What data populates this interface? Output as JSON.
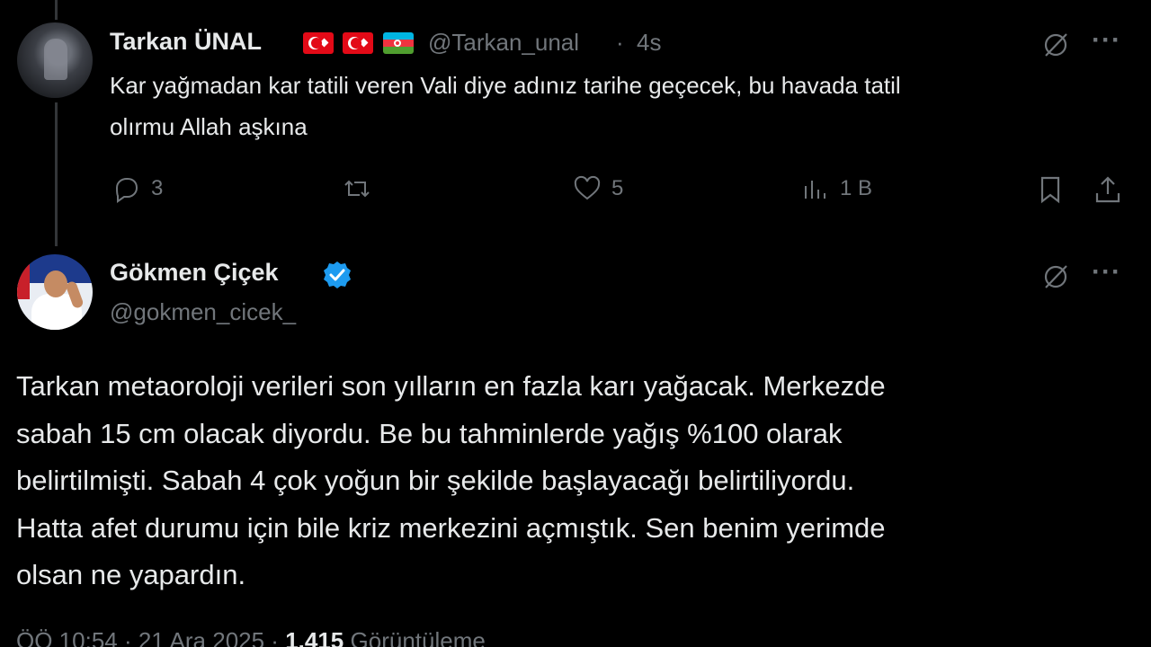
{
  "reply_tweet": {
    "author_name": "Tarkan ÜNAL",
    "handle": "@Tarkan_unal",
    "separator": "·",
    "time": "4s",
    "flags": [
      "turkey-flag",
      "turkey-flag",
      "azerbaijan-flag"
    ],
    "text_line1": "Kar yağmadan kar tatili veren Vali diye adınız tarihe geçecek, bu havada tatil",
    "text_line2": "olırmu Allah aşkına",
    "actions": {
      "replies": "3",
      "reposts": "",
      "likes": "5",
      "views": "1 B"
    }
  },
  "main_tweet": {
    "author_name": "Gökmen Çiçek",
    "handle": "@gokmen_cicek_",
    "verified": true,
    "lines": [
      "Tarkan metaoroloji verileri son yılların en fazla karı yağacak. Merkezde",
      "sabah 15 cm olacak diyordu. Be bu tahminlerde yağış %100 olarak",
      "belirtilmişti. Sabah 4 çok yoğun bir şekilde başlayacağı belirtiliyordu.",
      "Hatta afet durumu için bile kriz merkezini açmıştık. Sen benim yerimde",
      "olsan ne yapardın."
    ],
    "footer": {
      "timestamp": "ÖÖ 10:54 · 21 Ara 2025 ·",
      "views_count": "1.415",
      "views_label": "Görüntüleme"
    }
  },
  "colors": {
    "background": "#000000",
    "text_primary": "#e7e9ea",
    "text_secondary": "#71767b",
    "verified_blue": "#1d9bf0"
  }
}
